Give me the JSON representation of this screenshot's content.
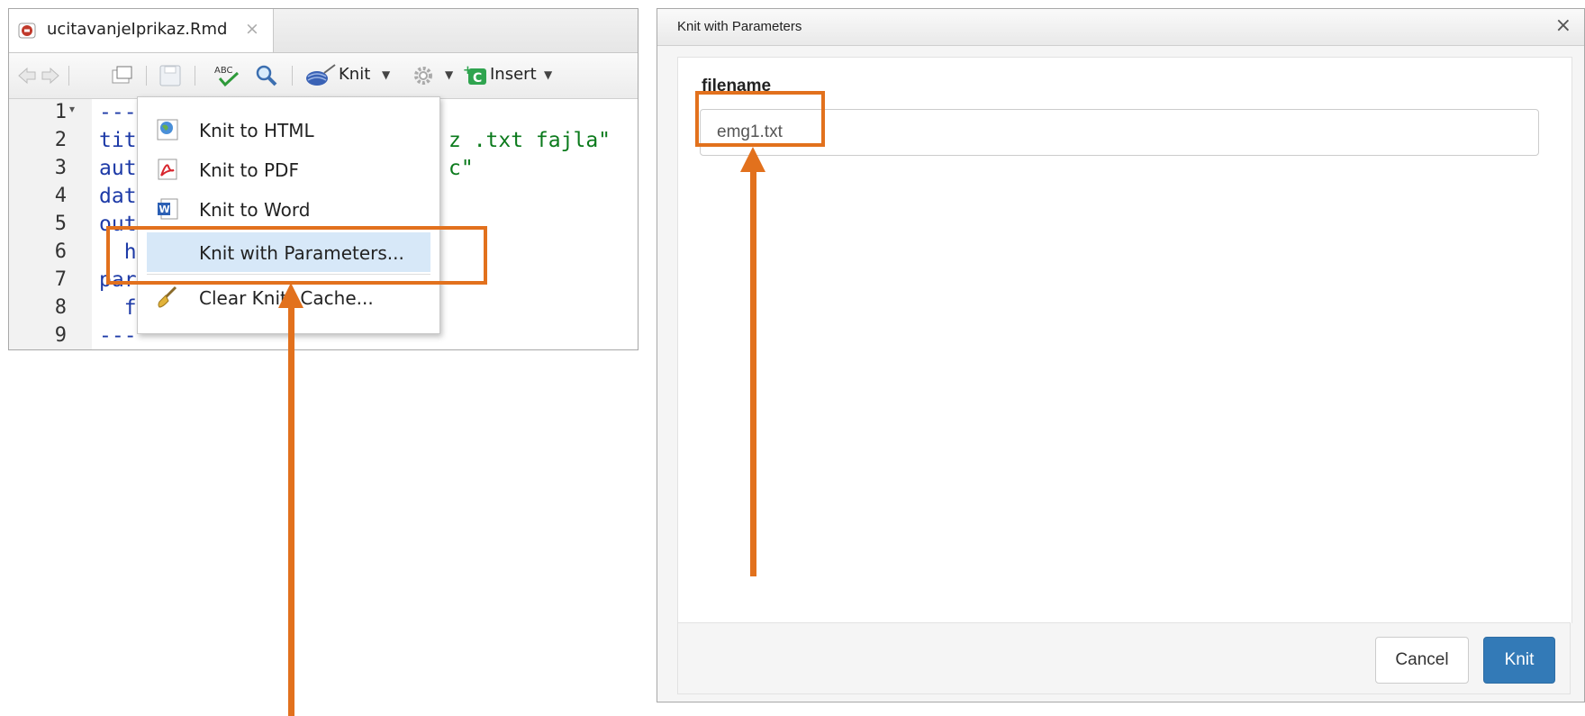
{
  "editor": {
    "tab": {
      "filename": "ucitavanjeIprikaz.Rmd",
      "close_glyph": "×"
    },
    "toolbar": {
      "knit_label": "Knit",
      "insert_label": "Insert",
      "spell_icon_text": "ABC"
    },
    "lines": [
      {
        "num": "1",
        "fold": "▾",
        "text": "---"
      },
      {
        "num": "2",
        "text": "tit",
        "tail": "z .txt fajla\""
      },
      {
        "num": "3",
        "text": "aut",
        "tail": "c\""
      },
      {
        "num": "4",
        "text": "dat"
      },
      {
        "num": "5",
        "text": "out"
      },
      {
        "num": "6",
        "text": "  ht"
      },
      {
        "num": "7",
        "text": "par"
      },
      {
        "num": "8",
        "text": "  f"
      },
      {
        "num": "9",
        "text": "---"
      }
    ]
  },
  "knit_menu": {
    "items": [
      {
        "label": "Knit to HTML",
        "icon": "globe-html-icon"
      },
      {
        "label": "Knit to PDF",
        "icon": "pdf-icon"
      },
      {
        "label": "Knit to Word",
        "icon": "word-icon"
      },
      {
        "label": "Knit with Parameters...",
        "icon": "none",
        "highlighted": true
      },
      {
        "label": "Clear Knitr Cache...",
        "icon": "broom-icon"
      }
    ]
  },
  "dialog": {
    "title": "Knit with Parameters",
    "close_glyph": "×",
    "param_label": "filename",
    "param_value": "emg1.txt",
    "cancel_label": "Cancel",
    "knit_label": "Knit"
  },
  "colors": {
    "highlight": "#e2711d",
    "knit_button": "#337ab7",
    "keyword": "#1d3aa7",
    "string": "#0b7a1c"
  }
}
